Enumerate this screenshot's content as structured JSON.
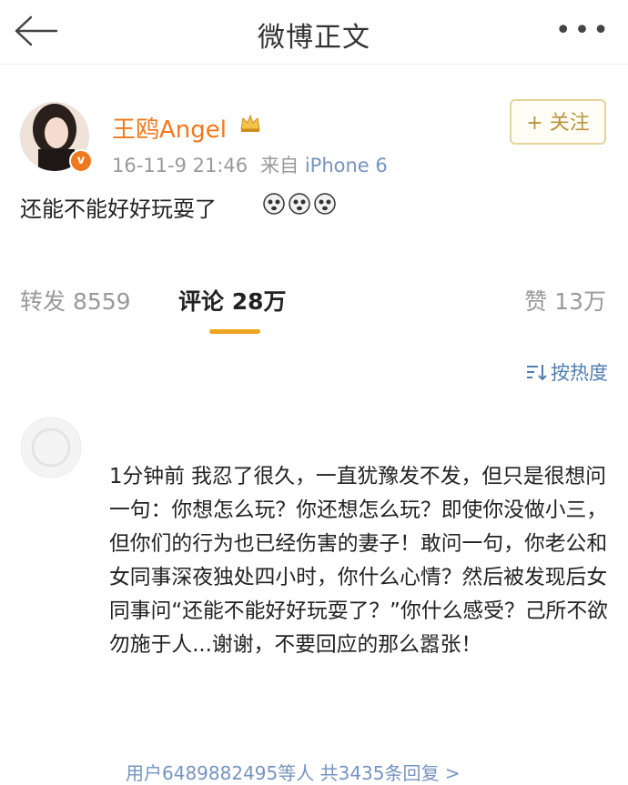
{
  "header": {
    "title": "微博正文",
    "more_glyph": "•••"
  },
  "post": {
    "username": "王鸥Angel",
    "verified_glyph": "v",
    "timestamp": "16-11-9 21:46",
    "source": "来自",
    "client": "iPhone 6",
    "follow_label": "+ 关注",
    "text": "还能不能好好玩耍了"
  },
  "tabs": {
    "repost": "转发 8559",
    "comment": "评论 28万",
    "like": "赞 13万"
  },
  "sort": {
    "label": "按热度"
  },
  "comment": {
    "text": "1分钟前 我忍了很久，一直犹豫发不发，但只是很想问一句：你想怎么玩？你还想怎么玩？即使你没做小三，但你们的行为也已经伤害的妻子！敢问一句，你老公和女同事深夜独处四小时，你什么心情？然后被发现后女同事问“还能不能好好玩耍了？”你什么感受？己所不欲 勿施于人...谢谢，不要回应的那么嚣张！",
    "reply_summary": "用户6489882495等人 共3435条回复 >"
  },
  "colors": {
    "brand_orange": "#f0781e",
    "link_blue": "#7693bf",
    "tab_underline": "#f0a31e",
    "follow_border": "#e3d49c"
  },
  "icons": [
    "back-arrow-icon",
    "more-icon",
    "verified-icon",
    "crown-icon",
    "emoji-icon",
    "sort-icon"
  ]
}
